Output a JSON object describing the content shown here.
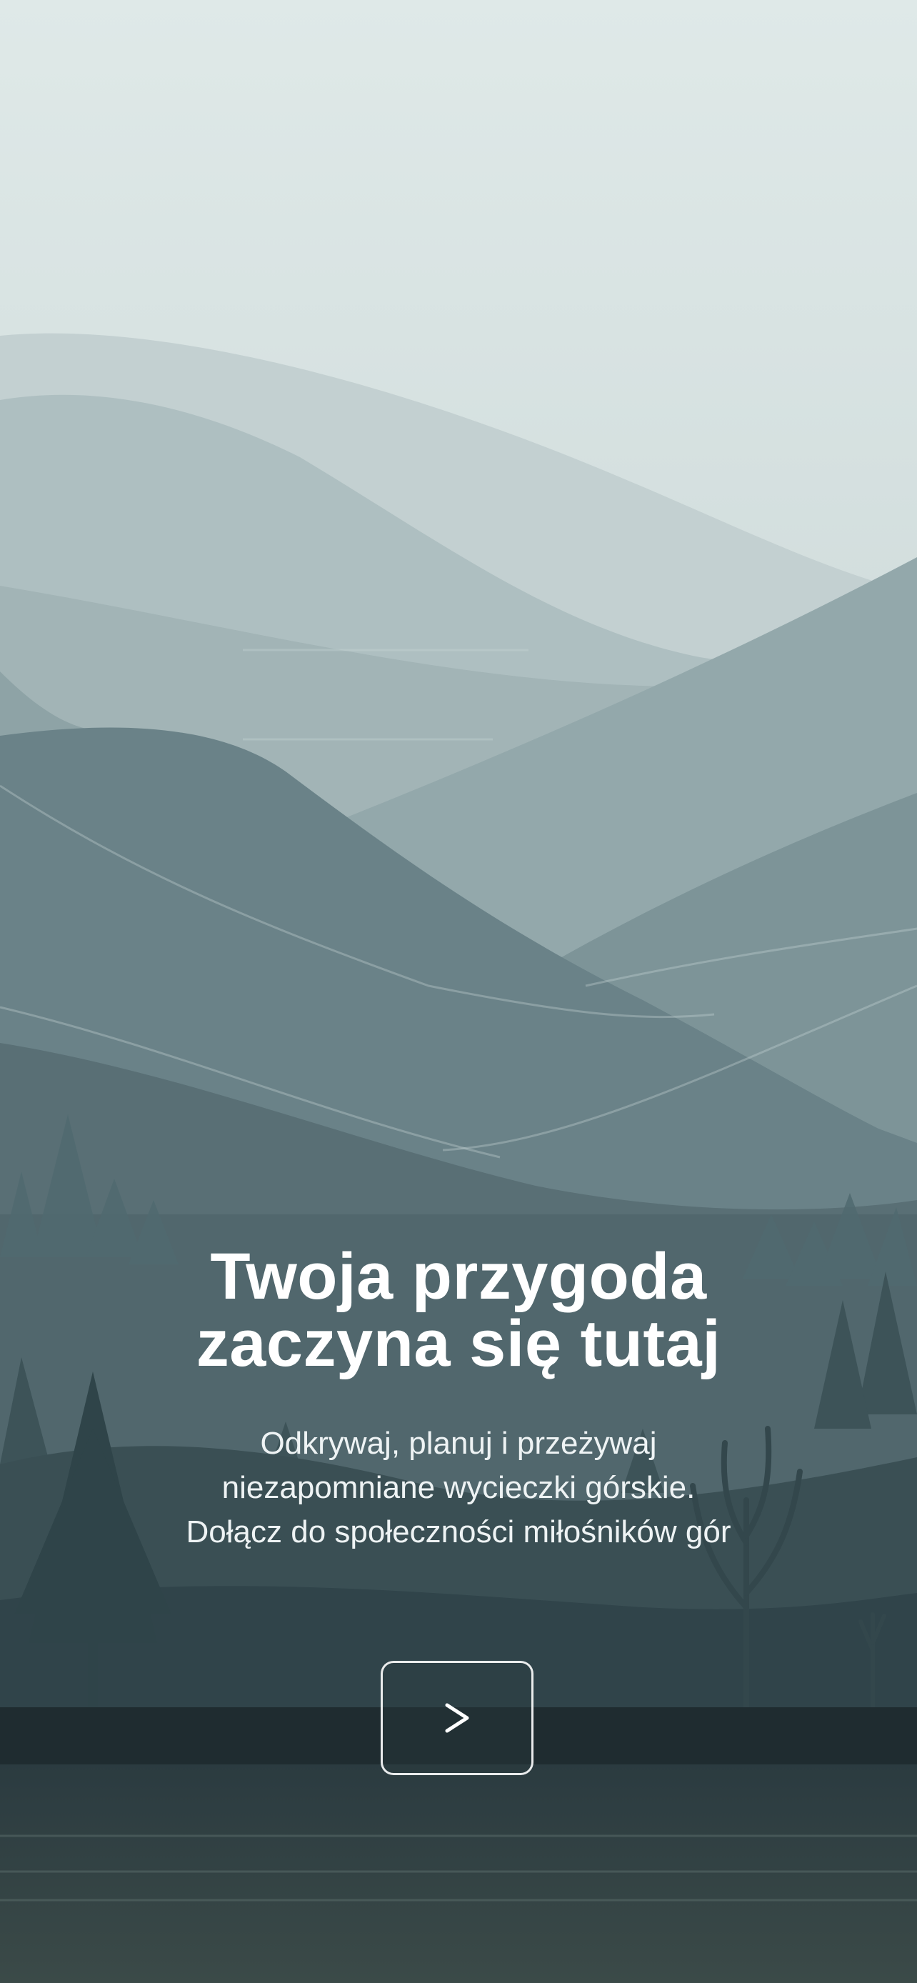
{
  "onboarding": {
    "headline_line1": "Twoja przygoda",
    "headline_line2": "zaczyna się tutaj",
    "subtitle_line1": "Odkrywaj, planuj i przeżywaj",
    "subtitle_line2": "niezapomniane wycieczki górskie.",
    "subtitle_line3": "Dołącz do społeczności miłośników gór",
    "next_icon": "chevron-right-icon"
  },
  "colors": {
    "sky_top": "#dfe9e8",
    "mountains": "#5e767d",
    "forest": "#2f4348",
    "ground": "#1f2c30",
    "text": "#ffffff"
  }
}
